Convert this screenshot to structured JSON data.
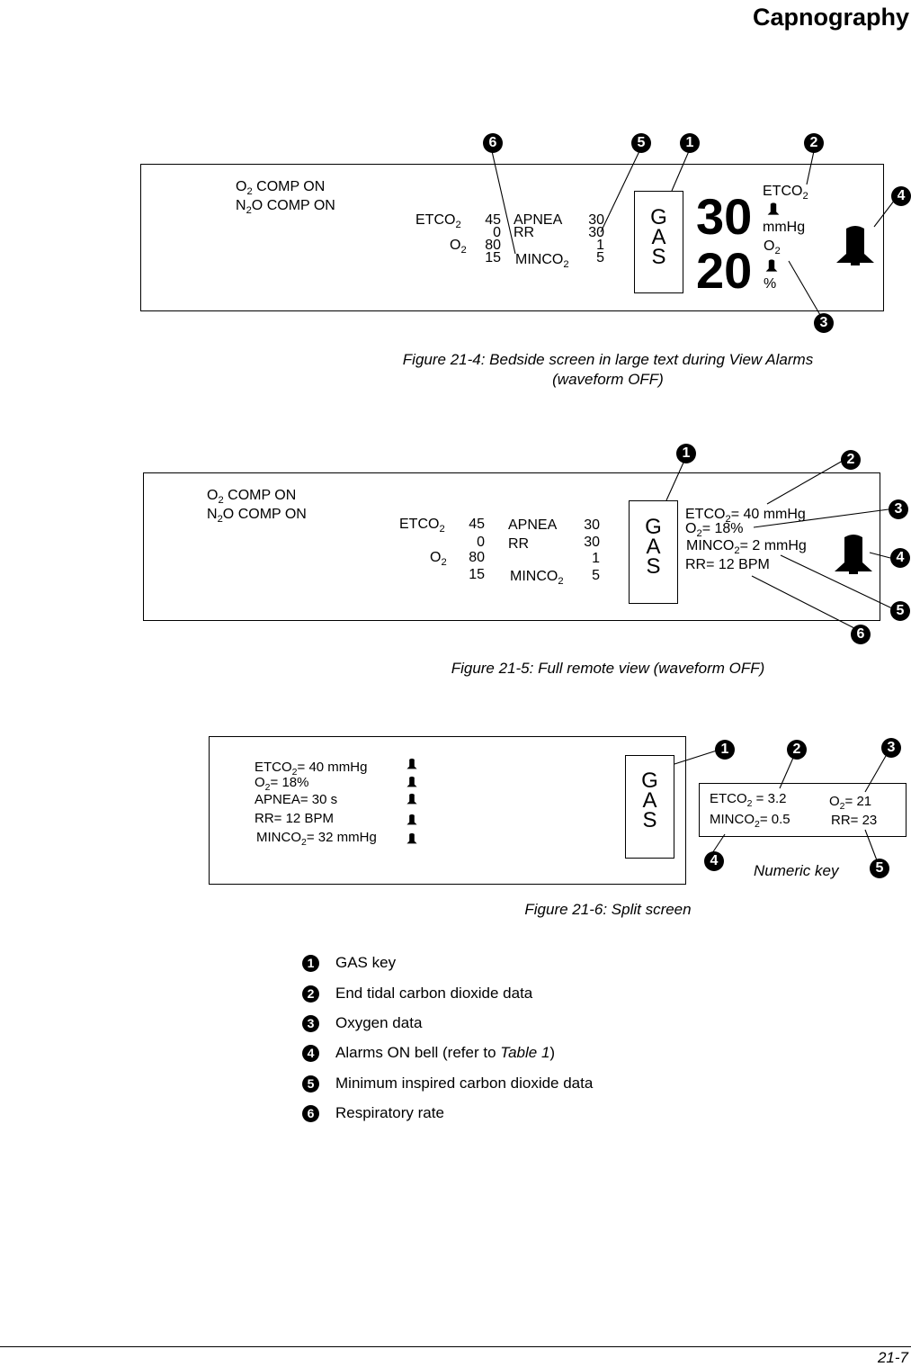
{
  "header": {
    "title": "Capnography"
  },
  "footer": {
    "page_number": "21-7"
  },
  "labels": {
    "etco2": "ETCO",
    "o2": "O",
    "minco2": "MINCO",
    "sub2": "2",
    "apnea": "APNEA",
    "rr": "RR",
    "gas_key": [
      "G",
      "A",
      "S"
    ],
    "o2_comp_prefix": "O",
    "o2_comp_suffix": " COMP ON",
    "n2o_comp_prefix": "N",
    "n2o_comp_suffix": "O COMP ON"
  },
  "alarm_limits": {
    "etco2_high": "45",
    "etco2_low": "0",
    "o2_high": "80",
    "o2_low": "15",
    "apnea": "30",
    "rr_high": "30",
    "rr_low": "1",
    "minco2": "5"
  },
  "figure_21_4": {
    "caption_line1": "Figure 21-4:  Bedside screen in large text during View Alarms",
    "caption_line2": "(waveform OFF)",
    "etco2_value": "30",
    "etco2_unit": "mmHg",
    "o2_value": "20",
    "o2_unit": "%",
    "callouts": [
      "6",
      "5",
      "1",
      "2",
      "4",
      "3"
    ]
  },
  "figure_21_5": {
    "caption": "Figure 21-5:  Full remote view (waveform OFF)",
    "readings": {
      "etco2": "= 40 mmHg",
      "o2": "= 18%",
      "minco2": "= 2 mmHg",
      "rr": "RR= 12 BPM"
    },
    "callouts": [
      "1",
      "2",
      "3",
      "4",
      "5",
      "6"
    ]
  },
  "figure_21_6": {
    "caption": "Figure 21-6:  Split screen",
    "readings": {
      "etco2": "= 40 mmHg",
      "o2": "= 18%",
      "apnea": "APNEA= 30 s",
      "rr": "RR= 12 BPM",
      "minco2": "= 32 mmHg"
    },
    "numeric_key": {
      "label": "Numeric key",
      "etco2": " = 3.2",
      "minco2": "= 0.5",
      "o2": "= 21",
      "rr": "RR= 23"
    },
    "callouts": [
      "1",
      "2",
      "3",
      "4",
      "5"
    ]
  },
  "legend": [
    {
      "num": "1",
      "text": "GAS key"
    },
    {
      "num": "2",
      "text": "End tidal carbon dioxide data"
    },
    {
      "num": "3",
      "text": "Oxygen data"
    },
    {
      "num": "4",
      "text_before": "Alarms ON bell (refer to ",
      "text_italic": "Table 1",
      "text_after": ")"
    },
    {
      "num": "5",
      "text": "Minimum inspired carbon dioxide data"
    },
    {
      "num": "6",
      "text": "Respiratory rate"
    }
  ]
}
